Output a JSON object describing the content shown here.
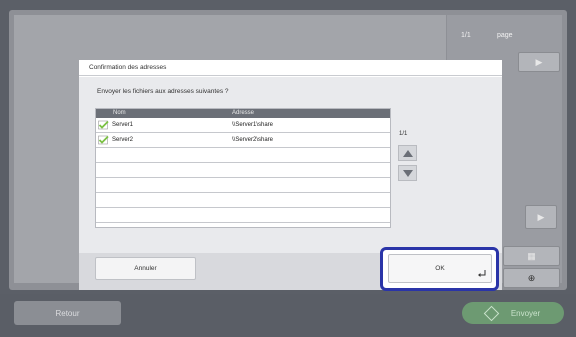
{
  "background": {
    "pages": "1/1",
    "page_label": "page",
    "retour": "Retour",
    "envoyer": "Envoyer"
  },
  "dialog": {
    "title": "Confirmation des adresses",
    "question": "Envoyer les fichiers aux adresses suivantes ?",
    "columns": {
      "name": "Nom",
      "address": "Adresse"
    },
    "rows": [
      {
        "name": "Server1",
        "address": "\\\\Server1\\share",
        "checked": true
      },
      {
        "name": "Server2",
        "address": "\\\\Server2\\share",
        "checked": true
      }
    ],
    "pager": "1/1",
    "cancel": "Annuler",
    "ok": "OK"
  },
  "colors": {
    "accent_ring": "#2a34a8",
    "check": "#7ac143",
    "send": "#6d9a72"
  },
  "icons": [
    "check-icon",
    "arrow-up-icon",
    "arrow-down-icon",
    "enter-icon",
    "send-icon",
    "zoom-icon",
    "layout-icon"
  ]
}
